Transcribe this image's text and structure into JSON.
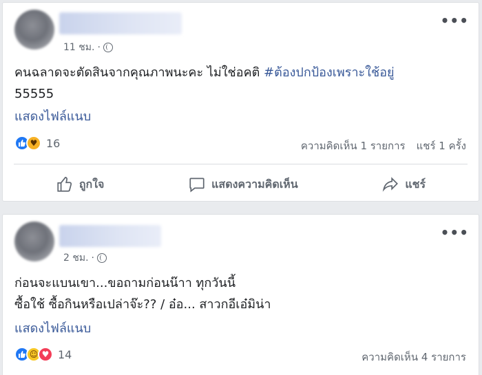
{
  "post1": {
    "time": "11 ชม.",
    "separator": "·",
    "more_icon": "more-options-icon",
    "text_line1": "คนฉลาดจะตัดสินจากคุณภาพนะคะ ไม่ใช่อคติ ",
    "hashtag": "#ต้องปกป้องเพราะใช้อยู่",
    "text_line2": "55555",
    "translate_label": "แสดงไฟล์แนบ",
    "reactions": [
      "like",
      "care"
    ],
    "reaction_count": "16",
    "comments": "ความคิดเห็น 1 รายการ",
    "shares": "แชร์ 1 ครั้ง",
    "actions": {
      "like": "ถูกใจ",
      "comment": "แสดงความคิดเห็น",
      "share": "แชร์"
    }
  },
  "post2": {
    "time": "2 ชม.",
    "separator": "·",
    "more_icon": "more-options-icon",
    "text_line1": "ก่อนจะแบนเขา...ขอถามก่อนน๊าา ทุกวันนี้",
    "text_line2": "ซื้อใช้ ซื้อกินหรือเปล่าจ๊ะ?? / อ๋อ... สาวกอีเอ๋มิน่า",
    "translate_label": "แสดงไฟล์แนบ",
    "reactions": [
      "like",
      "haha",
      "love"
    ],
    "reaction_count": "14",
    "comments": "ความคิดเห็น 4 รายการ"
  },
  "colors": {
    "link": "#385898",
    "like_blue": "#2078f4",
    "love_red": "#f33e58",
    "haha_yellow": "#f7c725",
    "muted": "#606770"
  }
}
